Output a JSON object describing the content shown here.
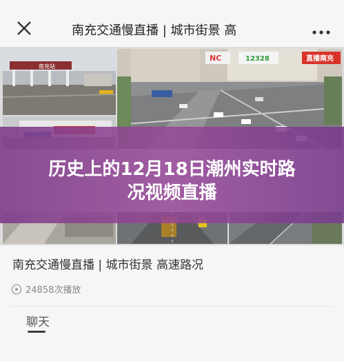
{
  "header": {
    "title": "南充交通慢直播 | 城市街景 高",
    "close_icon": "close-icon",
    "more_icon": "more-dots-icon"
  },
  "video": {
    "banner_line1": "历史上的12月18日潮州实时路",
    "banner_line2": "况视频直播",
    "signs": {
      "nc": "NC",
      "phone": "12328",
      "live": "直播南充",
      "gate": "南充站"
    }
  },
  "article": {
    "title": "南充交通慢直播 | 城市街景 高速路况",
    "views": "24858次播放"
  },
  "tabs": {
    "chat": "聊天"
  },
  "colors": {
    "banner": "#8a4a96",
    "live_badge": "#d8322a"
  }
}
